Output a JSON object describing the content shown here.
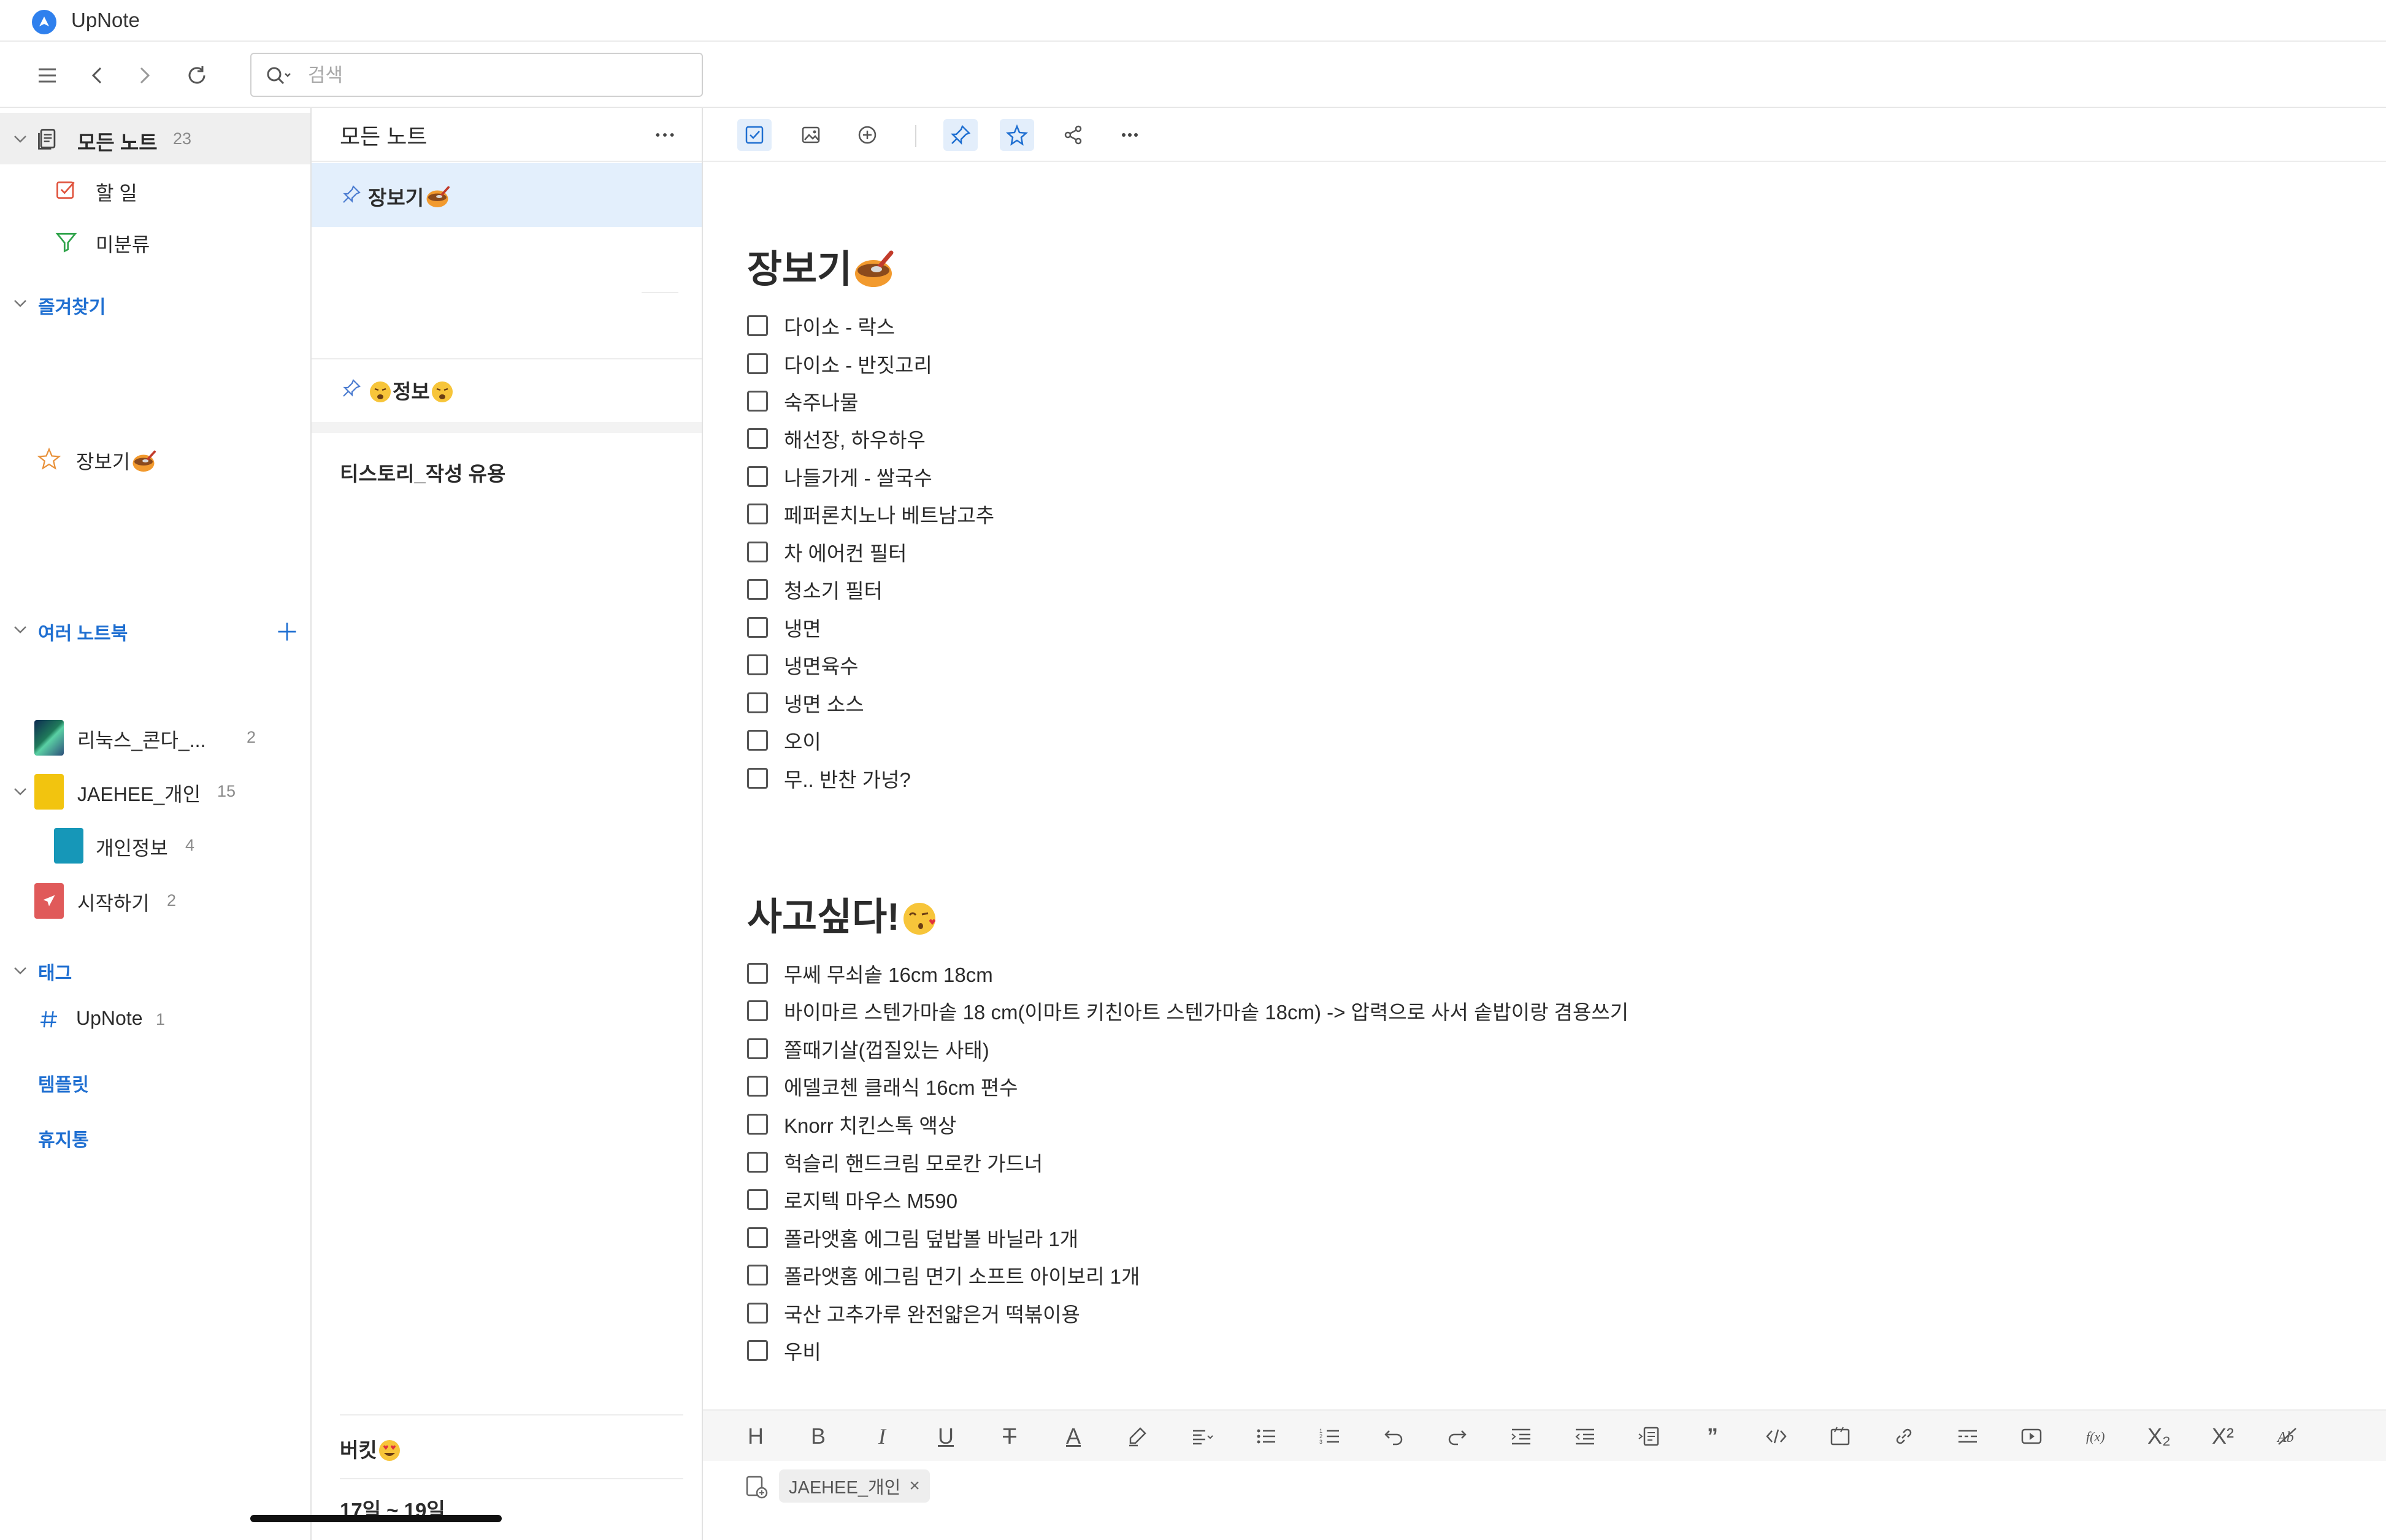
{
  "window": {
    "title": "UpNote"
  },
  "search": {
    "placeholder": "검색"
  },
  "sidebar": {
    "all_notes": {
      "label": "모든 노트",
      "count": "23"
    },
    "todo": {
      "label": "할 일"
    },
    "uncategorized": {
      "label": "미분류"
    },
    "favorites": {
      "label": "즐겨찾기",
      "items": [
        {
          "label": "장보기"
        }
      ]
    },
    "notebooks": {
      "label": "여러 노트북",
      "items": [
        {
          "label": "리눅스_콘다_...",
          "count": "2",
          "color": "#2c5f8a"
        },
        {
          "label": "JAEHEE_개인",
          "count": "15",
          "color": "#f2c40f"
        },
        {
          "label": "개인정보",
          "count": "4",
          "color": "#1697b8"
        },
        {
          "label": "시작하기",
          "count": "2",
          "color": "#e05a5a"
        }
      ]
    },
    "tags": {
      "label": "태그",
      "items": [
        {
          "label": "UpNote",
          "count": "1"
        }
      ]
    },
    "templates": {
      "label": "템플릿"
    },
    "trash": {
      "label": "휴지통"
    }
  },
  "note_list": {
    "title": "모든 노트",
    "items": [
      {
        "title": "장보기",
        "pinned": true,
        "selected": true
      },
      {
        "title": "정보",
        "pinned": true
      },
      {
        "title": "티스토리_작성 유용"
      },
      {
        "title": "버킷"
      },
      {
        "title": "17일 ~ 19일"
      }
    ]
  },
  "editor": {
    "section1": {
      "heading": "장보기",
      "items": [
        "다이소 - 락스",
        "다이소 - 반짓고리",
        "숙주나물",
        "해선장, 하우하우",
        "나들가게 - 쌀국수",
        "페퍼론치노나 베트남고추",
        "차 에어컨 필터",
        "청소기 필터",
        "냉면",
        "냉면육수",
        "냉면 소스",
        "오이",
        "무.. 반찬 가넝?"
      ]
    },
    "section2": {
      "heading": "사고싶다!",
      "items": [
        "무쎄 무쇠솥 16cm 18cm",
        "바이마르 스텐가마솥 18 cm(이마트 키친아트 스텐가마솥 18cm) -> 압력으로 사서 솥밥이랑 겸용쓰기",
        "쫄때기살(껍질있는 사태)",
        "에델코첸 클래식 16cm 편수",
        "Knorr 치킨스톡 액상",
        "헉슬리 핸드크림 모로칸 가드너",
        "로지텍 마우스 M590",
        "폴라앳홈 에그림 덮밥볼 바닐라 1개",
        "폴라앳홈 에그림 면기 소프트 아이보리 1개",
        "국산 고추가루 완전얇은거 떡볶이용",
        "우비"
      ]
    },
    "format_bar": {
      "heading": "H",
      "bold": "B",
      "italic": "I",
      "underline": "U",
      "strike": "T",
      "text_color": "A",
      "quote": "”",
      "subscript": "X₂",
      "superscript": "X²"
    },
    "tag": {
      "label": "JAEHEE_개인",
      "remove": "×"
    }
  },
  "colors": {
    "accent": "#1f6fd1",
    "selected_note_bg": "#e3effc",
    "active_sidebar_bg": "#efefef"
  }
}
